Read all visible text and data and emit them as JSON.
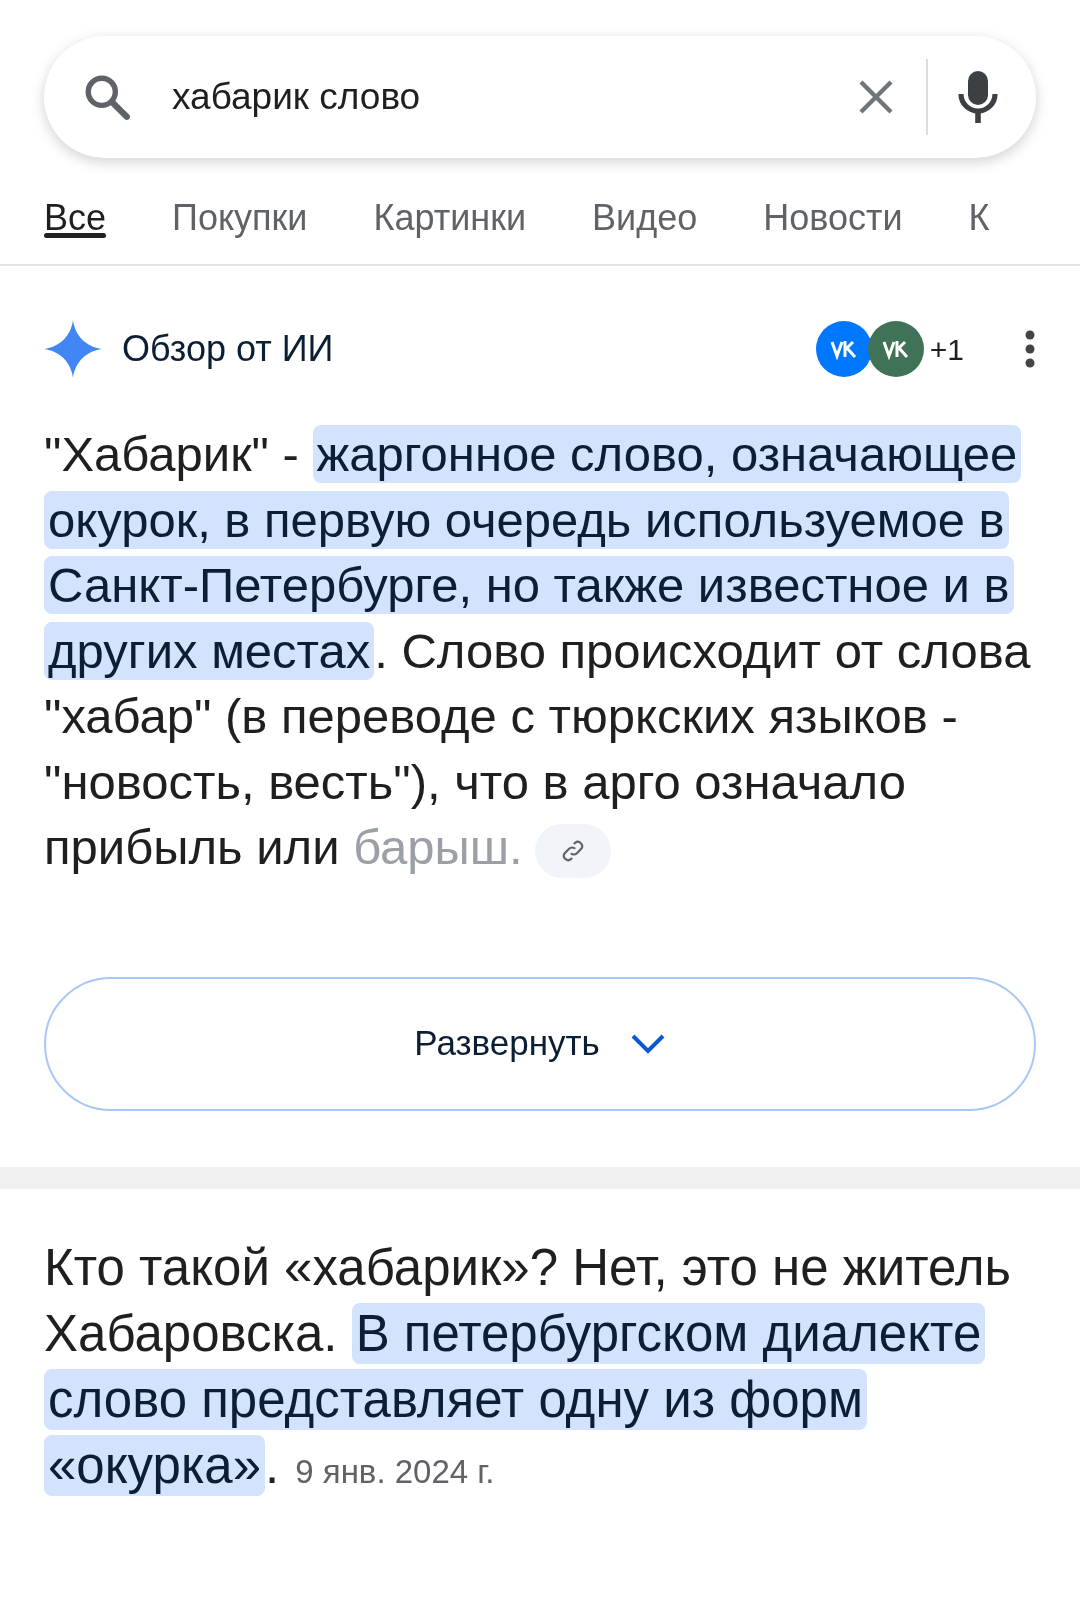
{
  "search": {
    "value": "хабарик слово"
  },
  "tabs": [
    {
      "label": "Все",
      "selected": true
    },
    {
      "label": "Покупки",
      "selected": false
    },
    {
      "label": "Картинки",
      "selected": false
    },
    {
      "label": "Видео",
      "selected": false
    },
    {
      "label": "Новости",
      "selected": false
    },
    {
      "label": "К",
      "selected": false
    }
  ],
  "ai_overview": {
    "title": "Обзор от ИИ",
    "sources": [
      {
        "color": "#0077ff"
      },
      {
        "color": "#3f7257"
      }
    ],
    "more_sources": "+1",
    "segments": [
      {
        "kind": "plain",
        "text": "\"Хабарик\" - "
      },
      {
        "kind": "highlight",
        "text": "жаргонное слово, означающее окурок, в первую очередь используемое в Санкт-Петербурге, но также известное и в других местах"
      },
      {
        "kind": "plain",
        "text": ". Слово происходит от слова \"хабар\" (в переводе с тюркских языков - \"новость, весть\"), что в арго означало прибыль или"
      },
      {
        "kind": "faded",
        "text": "барыш."
      }
    ],
    "expand_button": "Развернуть"
  },
  "snippet": {
    "segments": [
      {
        "kind": "plain",
        "text": "Кто такой «хабарик»? Нет, это не житель Хабаровска. "
      },
      {
        "kind": "highlight",
        "text": "В петербургском диалекте слово представляет одну из форм «окурка»"
      },
      {
        "kind": "plain",
        "text": "."
      }
    ],
    "date": "9 янв. 2024 г."
  }
}
